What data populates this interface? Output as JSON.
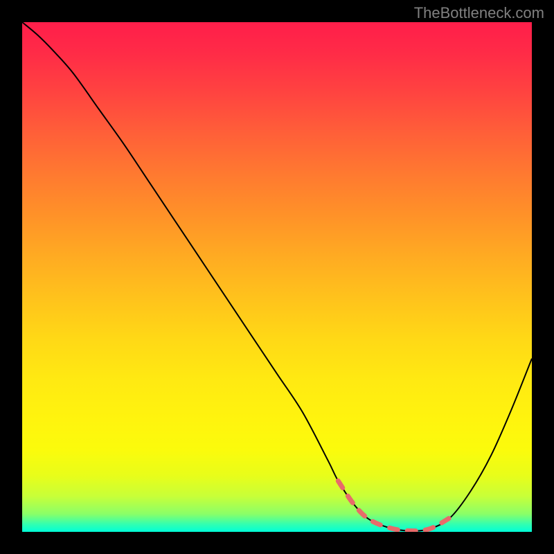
{
  "watermark": "TheBottleneck.com",
  "chart_data": {
    "type": "line",
    "title": "",
    "xlabel": "",
    "ylabel": "",
    "xlim": [
      0,
      100
    ],
    "ylim": [
      0,
      100
    ],
    "grid": false,
    "series": [
      {
        "name": "curve",
        "x": [
          0,
          3,
          6,
          10,
          15,
          20,
          25,
          30,
          35,
          40,
          45,
          50,
          55,
          60,
          62,
          65,
          68,
          72,
          76,
          80,
          84,
          88,
          92,
          96,
          100
        ],
        "y": [
          100,
          97.5,
          94.5,
          90,
          83,
          76,
          68.5,
          61,
          53.5,
          46,
          38.5,
          31,
          23.5,
          14,
          10,
          5.5,
          2.5,
          0.8,
          0.2,
          0.6,
          2.8,
          8,
          15,
          24,
          34
        ],
        "valley_segment": {
          "x_start": 62,
          "x_end": 84
        }
      }
    ],
    "gradient_stops": [
      {
        "pos": 0.0,
        "color": "#ff1e4a"
      },
      {
        "pos": 0.5,
        "color": "#ffc21c"
      },
      {
        "pos": 0.85,
        "color": "#fbfb0c"
      },
      {
        "pos": 1.0,
        "color": "#00ffd8"
      }
    ]
  }
}
